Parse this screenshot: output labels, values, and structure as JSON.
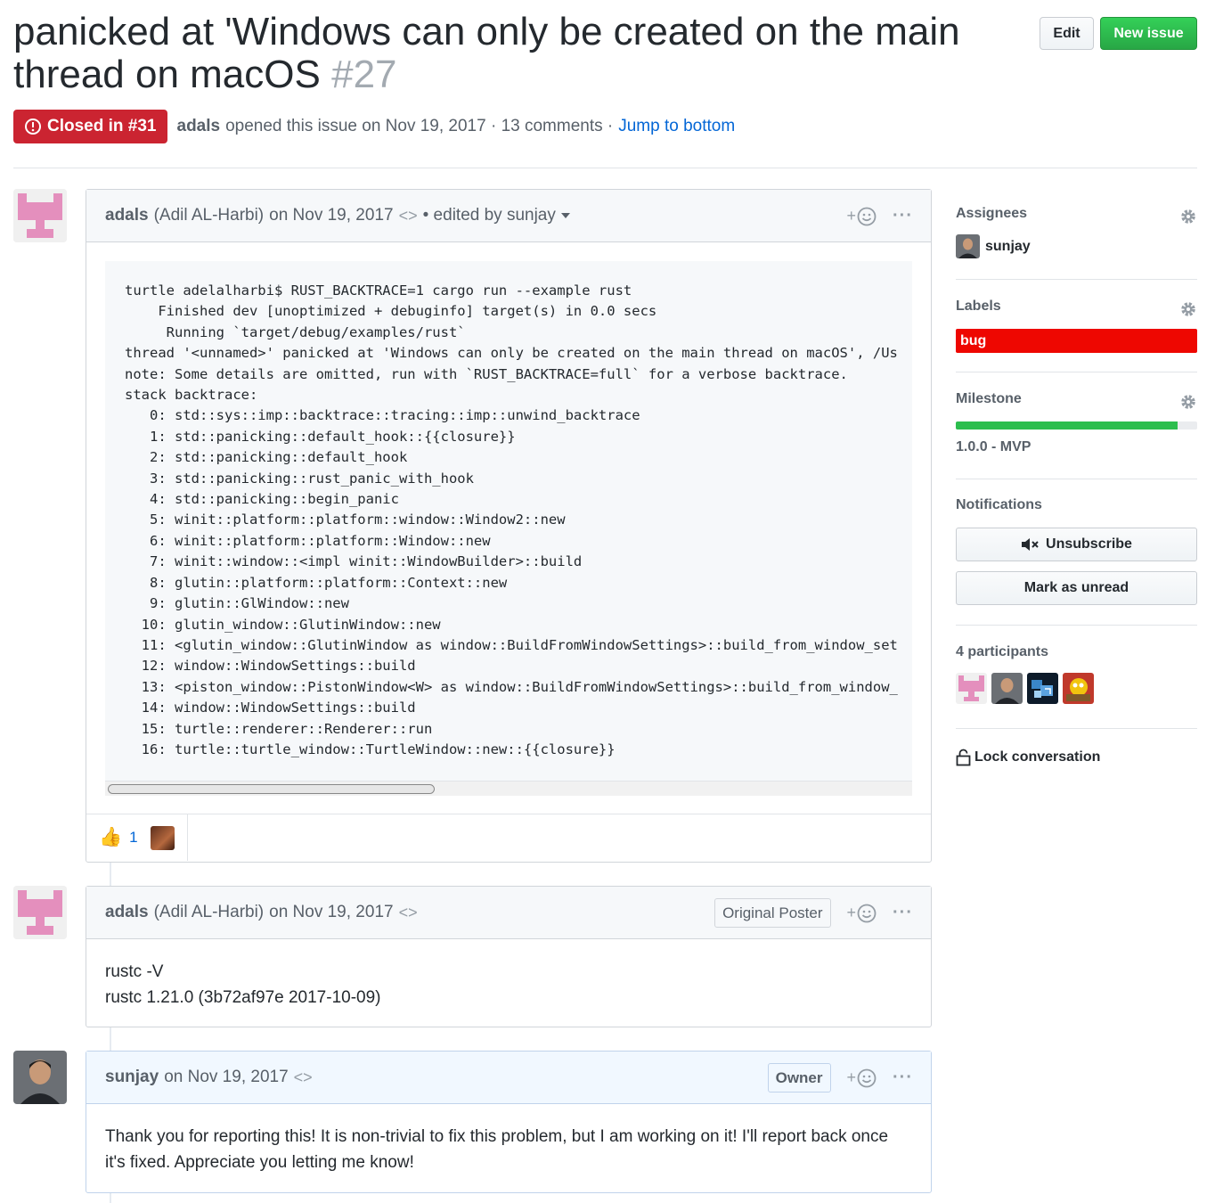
{
  "issue": {
    "title": "panicked at 'Windows can only be created on the main thread on macOS",
    "number": "#27",
    "state_label": "Closed in #31",
    "author": "adals",
    "opened_text": "opened this issue on Nov 19, 2017 · 13 comments ·",
    "jump_label": "Jump to bottom"
  },
  "header_buttons": {
    "edit": "Edit",
    "new_issue": "New issue"
  },
  "comments": [
    {
      "author": "adals",
      "fullname": "(Adil AL-Harbi)",
      "date": "on Nov 19, 2017",
      "edited": "• edited by sunjay",
      "code": "turtle adelalharbi$ RUST_BACKTRACE=1 cargo run --example rust\n    Finished dev [unoptimized + debuginfo] target(s) in 0.0 secs\n     Running `target/debug/examples/rust`\nthread '<unnamed>' panicked at 'Windows can only be created on the main thread on macOS', /Us\nnote: Some details are omitted, run with `RUST_BACKTRACE=full` for a verbose backtrace.\nstack backtrace:\n   0: std::sys::imp::backtrace::tracing::imp::unwind_backtrace\n   1: std::panicking::default_hook::{{closure}}\n   2: std::panicking::default_hook\n   3: std::panicking::rust_panic_with_hook\n   4: std::panicking::begin_panic\n   5: winit::platform::platform::window::Window2::new\n   6: winit::platform::platform::Window::new\n   7: winit::window::<impl winit::WindowBuilder>::build\n   8: glutin::platform::platform::Context::new\n   9: glutin::GlWindow::new\n  10: glutin_window::GlutinWindow::new\n  11: <glutin_window::GlutinWindow as window::BuildFromWindowSettings>::build_from_window_set\n  12: window::WindowSettings::build\n  13: <piston_window::PistonWindow<W> as window::BuildFromWindowSettings>::build_from_window_\n  14: window::WindowSettings::build\n  15: turtle::renderer::Renderer::run\n  16: turtle::turtle_window::TurtleWindow::new::{{closure}}",
      "reaction_count": "1"
    },
    {
      "author": "adals",
      "fullname": "(Adil AL-Harbi)",
      "date": "on Nov 19, 2017",
      "badge": "Original Poster",
      "body_line1": "rustc -V",
      "body_line2": "rustc 1.21.0 (3b72af97e 2017-10-09)"
    },
    {
      "author": "sunjay",
      "date": "on Nov 19, 2017",
      "badge": "Owner",
      "body": "Thank you for reporting this! It is non-trivial to fix this problem, but I am working on it! I'll report back once it's fixed. Appreciate you letting me know!"
    }
  ],
  "sidebar": {
    "assignees_title": "Assignees",
    "assignee": "sunjay",
    "labels_title": "Labels",
    "label": "bug",
    "label_color": "#ee0701",
    "milestone_title": "Milestone",
    "milestone": "1.0.0 - MVP",
    "milestone_progress": 0.92,
    "notifications_title": "Notifications",
    "unsubscribe": "Unsubscribe",
    "mark_unread": "Mark as unread",
    "participants_title": "4 participants",
    "lock": "Lock conversation"
  },
  "colors": {
    "closed": "#cb2431",
    "new_issue": "#28a745",
    "link": "#0366d6"
  }
}
